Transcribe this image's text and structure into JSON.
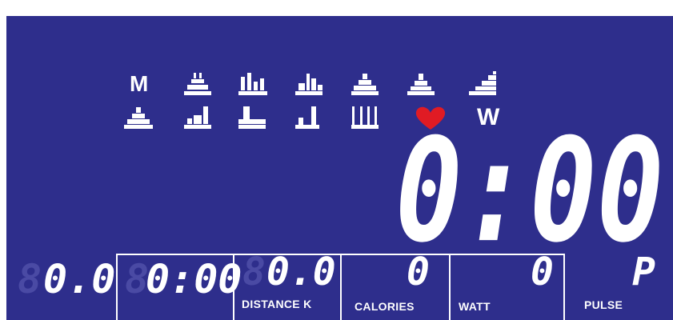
{
  "symbols": {
    "manual_label": "M",
    "watt_label": "W",
    "heart_color": "#e01b24"
  },
  "colors": {
    "panel": "#2e2e8c",
    "segment": "#ffffff"
  },
  "big_display": {
    "value": "0:00"
  },
  "cells": [
    {
      "value": "0.0",
      "label": ""
    },
    {
      "value": "0:00",
      "label": ""
    },
    {
      "value": "0.0",
      "label": "DISTANCE  K"
    },
    {
      "value": "0",
      "label": "CALORIES"
    },
    {
      "value": "0",
      "label": "WATT"
    },
    {
      "value": "P",
      "label": "PULSE"
    }
  ]
}
